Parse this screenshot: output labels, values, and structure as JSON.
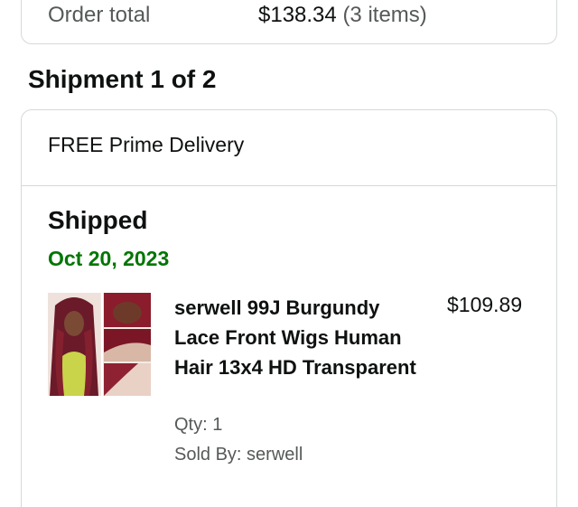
{
  "order_summary": {
    "label": "Order total",
    "amount": "$138.34",
    "items_count": "(3 items)"
  },
  "shipment": {
    "heading": "Shipment 1 of 2",
    "delivery_type": "FREE Prime Delivery",
    "status": "Shipped",
    "date": "Oct 20, 2023",
    "status_date_color": "#007600",
    "item": {
      "title": "serwell 99J Burgundy Lace Front Wigs Human Hair 13x4 HD Transparent",
      "price": "$109.89",
      "qty": "Qty: 1",
      "sold_by": "Sold By: serwell",
      "image_icon": "product-thumbnail"
    }
  }
}
